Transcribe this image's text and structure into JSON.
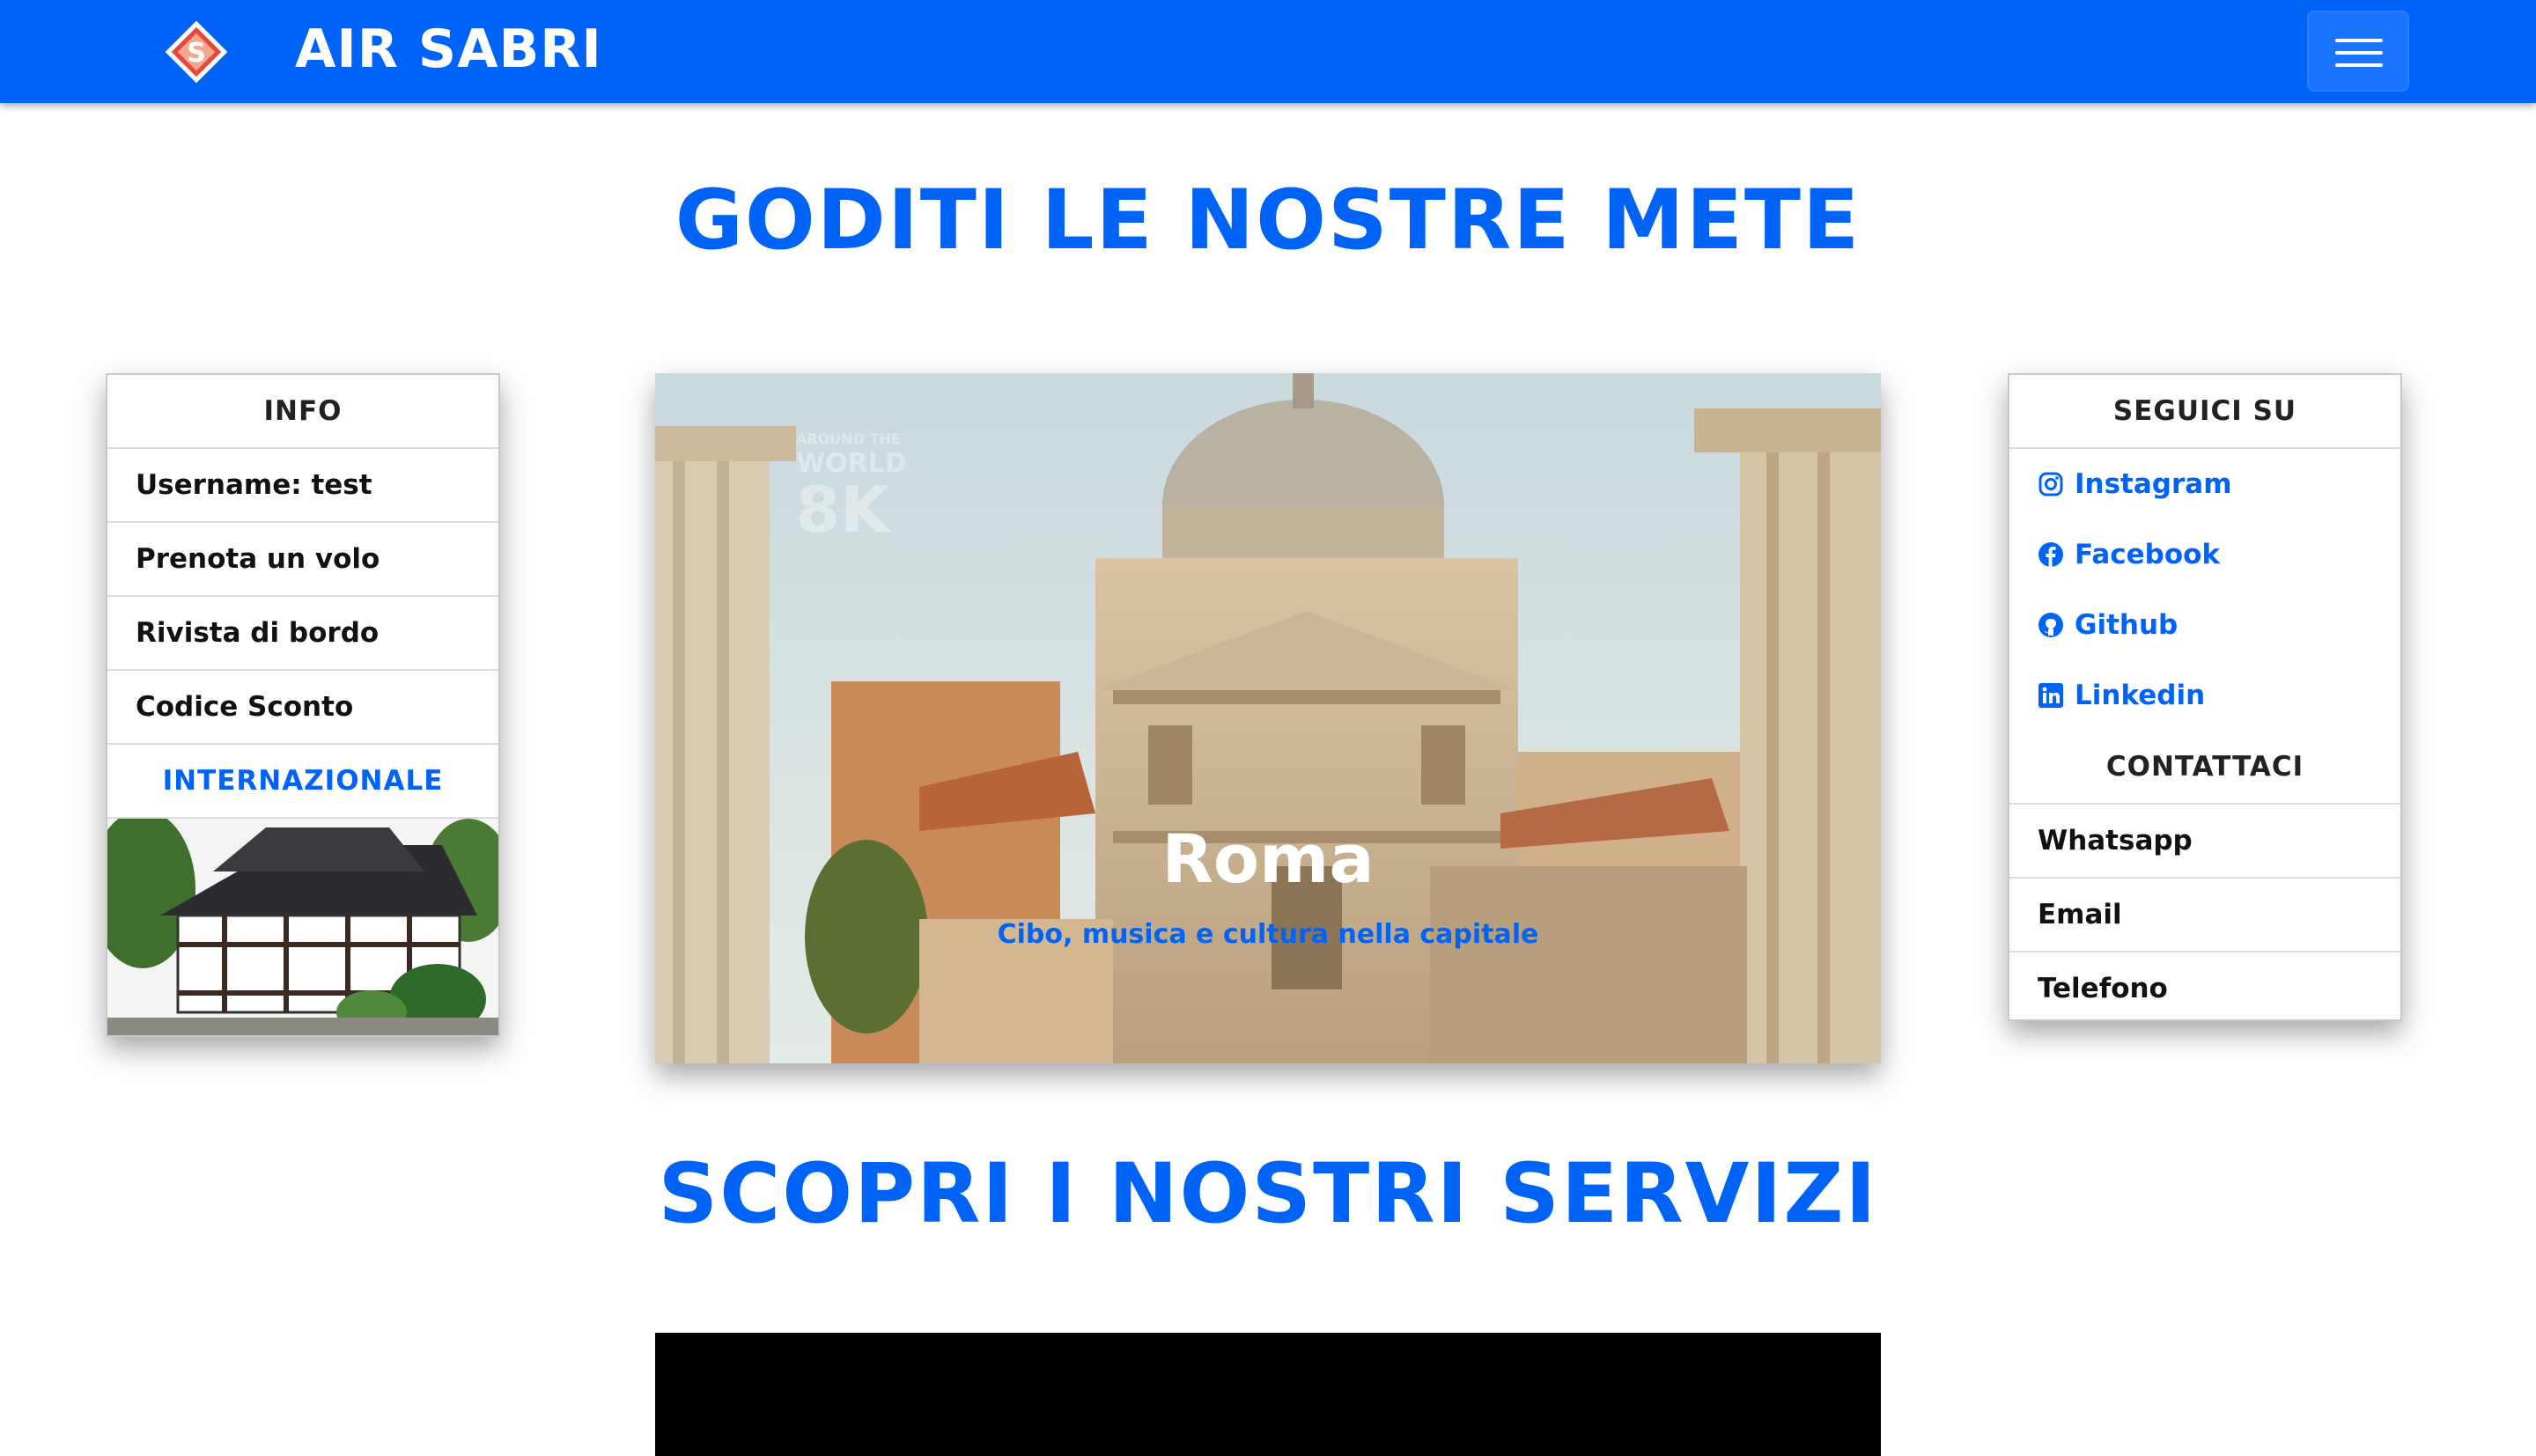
{
  "navbar": {
    "brand_title": "AIR SABRI",
    "logo_letter": "S",
    "brand_color": "#0063f7",
    "menu_icon": "hamburger-icon"
  },
  "headings": {
    "destinations": "GODITI LE NOSTRE METE",
    "services": "SCOPRI I NOSTRI SERVIZI"
  },
  "info_panel": {
    "title": "INFO",
    "items": [
      "Username: test",
      "Prenota un volo",
      "Rivista di bordo",
      "Codice Sconto"
    ],
    "highlight": "INTERNAZIONALE",
    "image_icon": "japanese-house-photo"
  },
  "carousel": {
    "slide_title": "Roma",
    "slide_subtitle": "Cibo, musica e cultura nella capitale",
    "watermark_line1": "AROUND THE",
    "watermark_line2": "WORLD",
    "watermark_line3": "8K"
  },
  "social_panel": {
    "title": "SEGUICI SU",
    "links": [
      {
        "label": "Instagram",
        "icon": "instagram-icon"
      },
      {
        "label": "Facebook",
        "icon": "facebook-icon"
      },
      {
        "label": "Github",
        "icon": "github-icon"
      },
      {
        "label": "Linkedin",
        "icon": "linkedin-icon"
      }
    ],
    "contact_title": "CONTATTACI",
    "contacts": [
      "Whatsapp",
      "Email",
      "Telefono"
    ]
  }
}
